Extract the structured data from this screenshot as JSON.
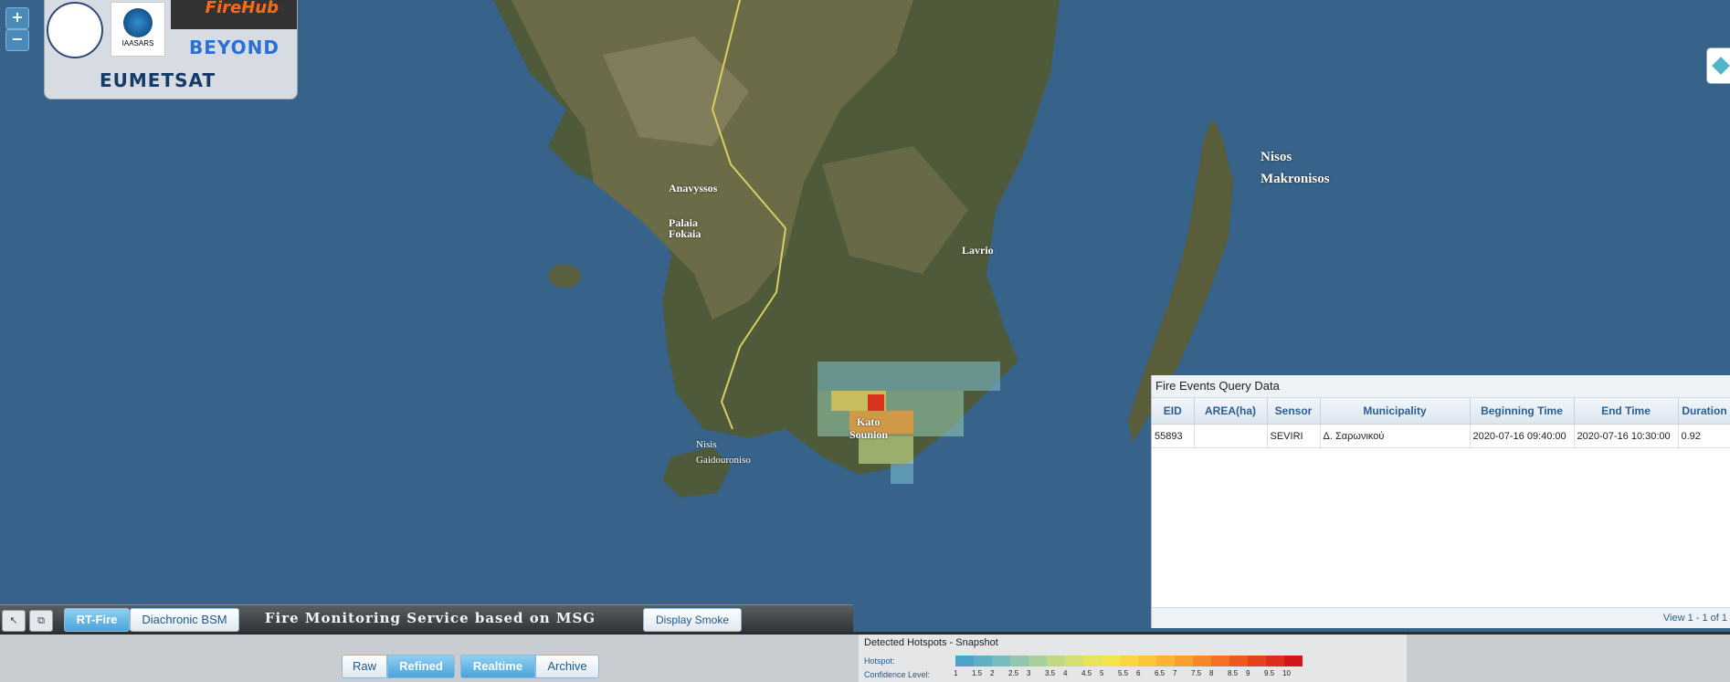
{
  "map": {
    "zoom_in": "+",
    "zoom_out": "−",
    "labels": [
      "Nisos",
      "Makronisos",
      "Anavyssos",
      "Palaia",
      "Fokaia",
      "Lavrio",
      "Kato",
      "Sounion",
      "Nisis",
      "Gaidouroniso"
    ]
  },
  "logos": {
    "iaasars": "IAASARS",
    "firehub": "FireHub",
    "beyond": "BEYOND",
    "eumetsat": "EUMETSAT"
  },
  "panel": {
    "title": "Fire Events Query Data",
    "columns": [
      "EID",
      "AREA(ha)",
      "Sensor",
      "Municipality",
      "Beginning Time",
      "End Time",
      "Duration"
    ],
    "rows": [
      [
        "55893",
        "",
        "SEVIRI",
        "Δ. Σαρωνικού",
        "2020-07-16 09:40:00",
        "2020-07-16 10:30:00",
        "0.92"
      ]
    ],
    "footer": "View 1 - 1 of 1"
  },
  "toolbar": {
    "tabs": [
      "RT-Fire",
      "Diachronic BSM"
    ],
    "title": "Fire Monitoring Service based on MSG SEVIRI",
    "smoke": "Display Smoke"
  },
  "bottom": {
    "mode": [
      "Raw",
      "Refined"
    ],
    "time": [
      "Realtime",
      "Archive"
    ],
    "legend_title": "Detected Hotspots - Snapshot",
    "hotspot_label": "Hotspot:",
    "confidence_label": "Confidence Level:",
    "confidence_levels": [
      "1",
      "1.5",
      "2",
      "2.5",
      "3",
      "3.5",
      "4",
      "4.5",
      "5",
      "5.5",
      "6",
      "6.5",
      "7",
      "7.5",
      "8",
      "8.5",
      "9",
      "9.5",
      "10"
    ],
    "legend_colors": [
      "#4aa3c8",
      "#5fb0c4",
      "#79bcbd",
      "#92c6af",
      "#a9cf9d",
      "#c1d886",
      "#d5df73",
      "#e7e35f",
      "#f5e24f",
      "#fbd545",
      "#fcc53e",
      "#fbb336",
      "#f99e30",
      "#f6882b",
      "#f27126",
      "#ec5a22",
      "#e5431f",
      "#dd2d1c",
      "#d4161a"
    ]
  }
}
